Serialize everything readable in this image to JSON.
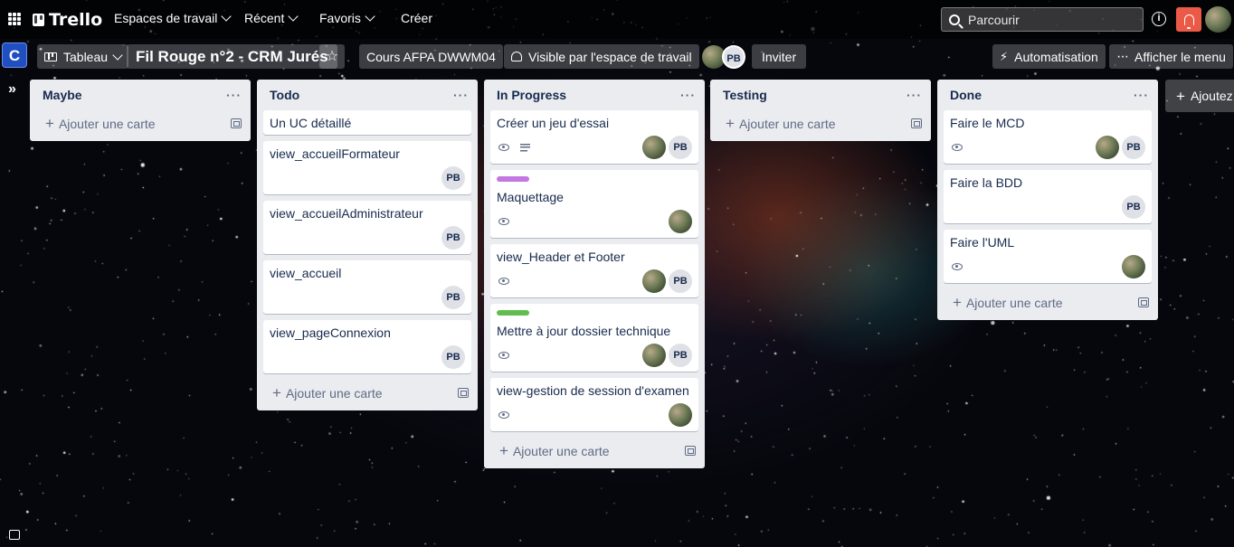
{
  "topbar": {
    "logo": "Trello",
    "nav": [
      {
        "label": "Espaces de travail"
      },
      {
        "label": "Récent"
      },
      {
        "label": "Favoris"
      }
    ],
    "create_label": "Créer",
    "search_placeholder": "Parcourir"
  },
  "board": {
    "view_label": "Tableau",
    "title": "Fil Rouge n°2 - CRM Jurés",
    "workspace_initial": "C",
    "workspace_label": "Cours AFPA DWWM04",
    "visibility_label": "Visible par l'espace de travail",
    "member_initials": "PB",
    "invite_label": "Inviter",
    "automation_label": "Automatisation",
    "menu_label": "Afficher le menu",
    "add_list_label": "Ajoutez une autre liste"
  },
  "add_card_label": "Ajouter une carte",
  "lists": [
    {
      "title": "Maybe",
      "cards": []
    },
    {
      "title": "Todo",
      "cards": [
        {
          "title": "Un UC détaillé",
          "watch": false,
          "desc": false,
          "members": []
        },
        {
          "title": "view_accueilFormateur",
          "watch": false,
          "desc": false,
          "members": [
            "PB"
          ]
        },
        {
          "title": "view_accueilAdministrateur",
          "watch": false,
          "desc": false,
          "members": [
            "PB"
          ]
        },
        {
          "title": "view_accueil",
          "watch": false,
          "desc": false,
          "members": [
            "PB"
          ]
        },
        {
          "title": "view_pageConnexion",
          "watch": false,
          "desc": false,
          "members": [
            "PB"
          ]
        }
      ]
    },
    {
      "title": "In Progress",
      "cards": [
        {
          "title": "Créer un jeu d'essai",
          "watch": true,
          "desc": true,
          "members": [
            "photo",
            "PB"
          ]
        },
        {
          "title": "Maquettage",
          "label_color": "#c377e0",
          "watch": true,
          "desc": false,
          "members": [
            "photo"
          ]
        },
        {
          "title": "view_Header et Footer",
          "watch": true,
          "desc": false,
          "members": [
            "photo",
            "PB"
          ]
        },
        {
          "title": "Mettre à jour dossier technique",
          "label_color": "#61bd4f",
          "watch": true,
          "desc": false,
          "members": [
            "photo",
            "PB"
          ]
        },
        {
          "title": "view-gestion de session d'examen",
          "watch": true,
          "desc": false,
          "members": [
            "photo"
          ]
        }
      ]
    },
    {
      "title": "Testing",
      "cards": []
    },
    {
      "title": "Done",
      "cards": [
        {
          "title": "Faire le MCD",
          "watch": true,
          "desc": false,
          "members": [
            "photo",
            "PB"
          ]
        },
        {
          "title": "Faire la BDD",
          "watch": false,
          "desc": false,
          "members": [
            "PB"
          ]
        },
        {
          "title": "Faire l'UML",
          "watch": true,
          "desc": false,
          "members": [
            "photo"
          ]
        }
      ]
    }
  ]
}
